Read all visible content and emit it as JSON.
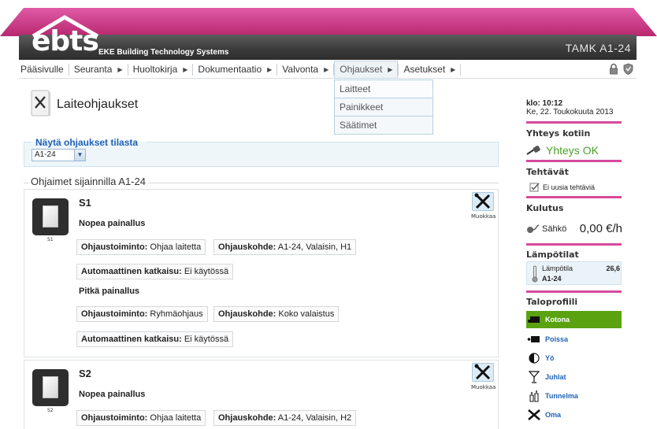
{
  "header": {
    "logo_text": "ebts",
    "logo_subtitle": "EKE Building Technology Systems",
    "site_name": "TAMK A1-24",
    "colors": {
      "roof": "#c8317f",
      "bar": "#3a3a3a",
      "accent": "#d64a9c"
    }
  },
  "menu": {
    "items": [
      {
        "label": "Pääsivulle",
        "has_arrow": false
      },
      {
        "label": "Seuranta",
        "has_arrow": true
      },
      {
        "label": "Huoltokirja",
        "has_arrow": true
      },
      {
        "label": "Dokumentaatio",
        "has_arrow": true
      },
      {
        "label": "Valvonta",
        "has_arrow": true
      },
      {
        "label": "Ohjaukset",
        "has_arrow": true
      },
      {
        "label": "Asetukset",
        "has_arrow": true
      }
    ],
    "icons": [
      "lock-icon",
      "shield-icon"
    ],
    "dropdown": [
      "Laitteet",
      "Painikkeet",
      "Säätimet"
    ]
  },
  "page": {
    "title": "Laiteohjaukset",
    "filter_legend": "Näytä ohjaukset tilasta",
    "filter_value": "A1-24",
    "group_title": "Ohjaimet sijainnilla A1-24",
    "edit_label": "Muokkaa"
  },
  "cards": {
    "s1": {
      "name": "S1",
      "code": "S1",
      "short_label": "Nopea painallus",
      "short_action_label": "Ohjaustoiminto:",
      "short_action_value": "Ohjaa laitetta",
      "short_target_label": "Ohjauskohde:",
      "short_target_value": "A1-24, Valaisin, H1",
      "short_auto_label": "Automaattinen katkaisu:",
      "short_auto_value": "Ei käytössä",
      "long_label": "Pitkä painallus",
      "long_action_label": "Ohjaustoiminto:",
      "long_action_value": "Ryhmäohjaus",
      "long_target_label": "Ohjauskohde:",
      "long_target_value": "Koko valaistus",
      "long_auto_label": "Automaattinen katkaisu:",
      "long_auto_value": "Ei käytössä"
    },
    "s2": {
      "name": "S2",
      "code": "S2",
      "short_label": "Nopea painallus",
      "short_action_label": "Ohjaustoiminto:",
      "short_action_value": "Ohjaa laitetta",
      "short_target_label": "Ohjauskohde:",
      "short_target_value": "A1-24, Valaisin, H2"
    }
  },
  "sidebar": {
    "time": "klo: 10:12",
    "date": "Ke, 22. Toukokuuta 2013",
    "connection_head": "Yhteys kotiin",
    "connection_status": "Yhteys OK",
    "tasks_head": "Tehtävät",
    "tasks_text": "Ei uusia tehtäviä",
    "consumption_head": "Kulutus",
    "electricity_label": "Sähkö",
    "electricity_value": "0,00 €/h",
    "temperature_head": "Lämpötilat",
    "temperature_name": "Lämpötila",
    "temperature_location": "A1-24",
    "temperature_value": "26,6",
    "profile_head": "Taloprofiili",
    "profiles": [
      "Kotona",
      "Poissa",
      "Yö",
      "Juhlat",
      "Tunnelma",
      "Oma"
    ],
    "active_profile": "Kotona"
  }
}
